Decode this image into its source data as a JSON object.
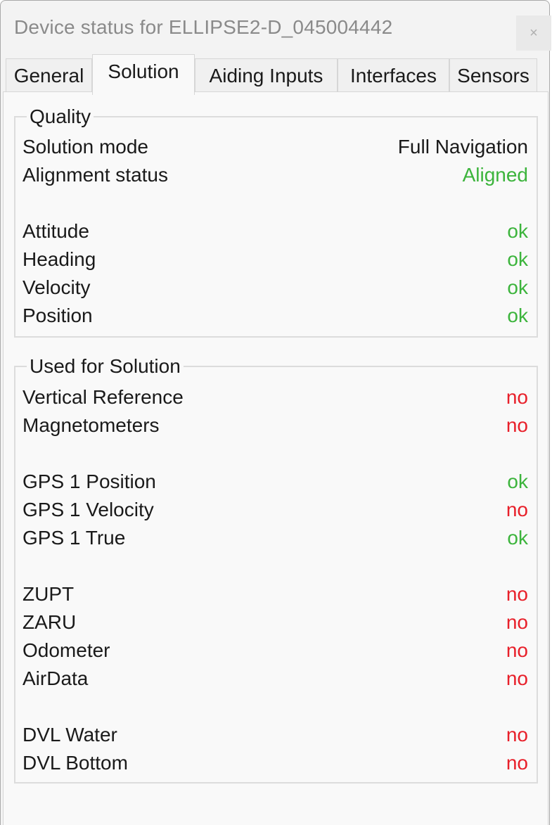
{
  "window": {
    "title": "Device status for ELLIPSE2-D_045004442",
    "close_label": "×"
  },
  "colors": {
    "ok": "#3cb43c",
    "no": "#e8202a",
    "text": "#1a1a1a"
  },
  "tabs": [
    {
      "label": "General",
      "active": false
    },
    {
      "label": "Solution",
      "active": true
    },
    {
      "label": "Aiding Inputs",
      "active": false
    },
    {
      "label": "Interfaces",
      "active": false
    },
    {
      "label": "Sensors",
      "active": false
    }
  ],
  "quality": {
    "title": "Quality",
    "rows": [
      {
        "label": "Solution mode",
        "value": "Full Navigation",
        "status": "neutral"
      },
      {
        "label": "Alignment status",
        "value": "Aligned",
        "status": "ok"
      },
      {
        "label": "Attitude",
        "value": "ok",
        "status": "ok"
      },
      {
        "label": "Heading",
        "value": "ok",
        "status": "ok"
      },
      {
        "label": "Velocity",
        "value": "ok",
        "status": "ok"
      },
      {
        "label": "Position",
        "value": "ok",
        "status": "ok"
      }
    ]
  },
  "used_for_solution": {
    "title": "Used for Solution",
    "rows": [
      {
        "label": "Vertical Reference",
        "value": "no",
        "status": "no"
      },
      {
        "label": "Magnetometers",
        "value": "no",
        "status": "no"
      },
      {
        "label": "GPS 1 Position",
        "value": "ok",
        "status": "ok"
      },
      {
        "label": "GPS 1 Velocity",
        "value": "no",
        "status": "no"
      },
      {
        "label": "GPS 1 True",
        "value": "ok",
        "status": "ok"
      },
      {
        "label": "ZUPT",
        "value": "no",
        "status": "no"
      },
      {
        "label": "ZARU",
        "value": "no",
        "status": "no"
      },
      {
        "label": "Odometer",
        "value": "no",
        "status": "no"
      },
      {
        "label": "AirData",
        "value": "no",
        "status": "no"
      },
      {
        "label": "DVL Water",
        "value": "no",
        "status": "no"
      },
      {
        "label": "DVL Bottom",
        "value": "no",
        "status": "no"
      }
    ]
  }
}
